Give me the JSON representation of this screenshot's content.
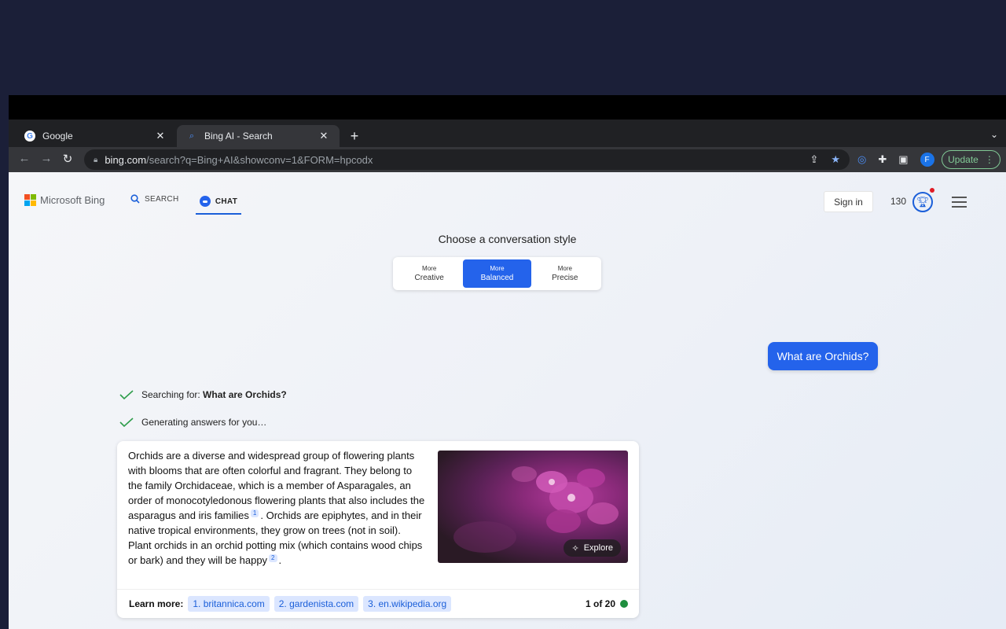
{
  "browser": {
    "tabs": [
      {
        "title": "Google",
        "favicon": "google-icon"
      },
      {
        "title": "Bing AI - Search",
        "favicon": "bing-search-icon"
      }
    ],
    "url_host": "bing.com",
    "url_path": "/search?q=Bing+AI&showconv=1&FORM=hpcodx",
    "profile_initial": "F",
    "update_label": "Update"
  },
  "header": {
    "brand": "Microsoft Bing",
    "nav_search": "SEARCH",
    "nav_chat": "CHAT",
    "sign_in": "Sign in",
    "points": "130"
  },
  "conversation_style": {
    "title": "Choose a conversation style",
    "options": [
      {
        "small": "More",
        "big": "Creative"
      },
      {
        "small": "More",
        "big": "Balanced",
        "active": true
      },
      {
        "small": "More",
        "big": "Precise"
      }
    ]
  },
  "chat": {
    "user_message": "What are Orchids?",
    "status_searching_prefix": "Searching for: ",
    "status_searching_query": "What are Orchids?",
    "status_generating": "Generating answers for you…",
    "answer_part1": "Orchids are a diverse and widespread group of flowering plants with blooms that are often colorful and fragrant. They belong to the family Orchidaceae, which is a member of Asparagales, an order of monocotyledonous flowering plants that also includes the asparagus and iris families",
    "cite1": "1",
    "answer_part2": ". Orchids are epiphytes, and in their native tropical environments, they grow on trees (not in soil). Plant orchids in an orchid potting mix (which contains wood chips or bark) and they will be happy",
    "cite2": "2",
    "answer_part3": ".",
    "explore_label": "Explore",
    "learn_more_label": "Learn more:",
    "learn_more_links": [
      "1. britannica.com",
      "2. gardenista.com",
      "3. en.wikipedia.org"
    ],
    "response_count": "1 of 20"
  }
}
